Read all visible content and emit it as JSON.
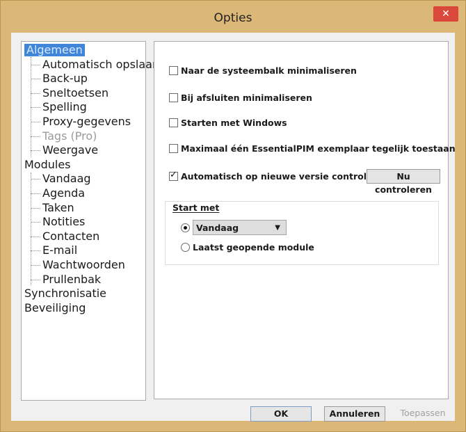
{
  "window": {
    "title": "Opties",
    "close_symbol": "✕"
  },
  "tree": {
    "items": [
      {
        "label": "Algemeen",
        "level": 0,
        "selected": true
      },
      {
        "label": "Automatisch opslaan",
        "level": 1
      },
      {
        "label": "Back-up",
        "level": 1
      },
      {
        "label": "Sneltoetsen",
        "level": 1
      },
      {
        "label": "Spelling",
        "level": 1
      },
      {
        "label": "Proxy-gegevens",
        "level": 1
      },
      {
        "label": "Tags (Pro)",
        "level": 1,
        "disabled": true
      },
      {
        "label": "Weergave",
        "level": 1
      },
      {
        "label": "Modules",
        "level": 0
      },
      {
        "label": "Vandaag",
        "level": 1
      },
      {
        "label": "Agenda",
        "level": 1
      },
      {
        "label": "Taken",
        "level": 1
      },
      {
        "label": "Notities",
        "level": 1
      },
      {
        "label": "Contacten",
        "level": 1
      },
      {
        "label": "E-mail",
        "level": 1
      },
      {
        "label": "Wachtwoorden",
        "level": 1
      },
      {
        "label": "Prullenbak",
        "level": 1
      },
      {
        "label": "Synchronisatie",
        "level": 0
      },
      {
        "label": "Beveiliging",
        "level": 0
      }
    ]
  },
  "options": {
    "minimize_tray": {
      "label": "Naar de systeembalk minimaliseren",
      "checked": false
    },
    "minimize_on_close": {
      "label": "Bij afsluiten minimaliseren",
      "checked": false
    },
    "start_with_windows": {
      "label": "Starten met Windows",
      "checked": false
    },
    "single_instance": {
      "label": "Maximaal één EssentialPIM exemplaar tegelijk toestaan",
      "checked": false
    },
    "auto_update": {
      "label": "Automatisch op nieuwe versie controlere",
      "checked": true
    },
    "check_now_label": "Nu controleren"
  },
  "start_group": {
    "label": "Start met",
    "radio_module_selected": true,
    "module_value": "Vandaag",
    "radio_last_label": "Laatst geopende module",
    "radio_last_selected": false
  },
  "footer": {
    "ok_label": "OK",
    "cancel_label": "Annuleren",
    "apply_label": "Toepassen"
  }
}
